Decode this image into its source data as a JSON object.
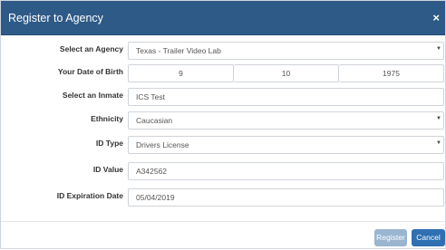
{
  "dialog": {
    "title": "Register to Agency",
    "close_glyph": "×"
  },
  "form": {
    "agency": {
      "label": "Select an Agency",
      "value": "Texas - Trailer Video Lab"
    },
    "dob": {
      "label": "Your Date of Birth",
      "month": "9",
      "day": "10",
      "year": "1975"
    },
    "inmate": {
      "label": "Select an Inmate",
      "value": "ICS Test"
    },
    "ethnicity": {
      "label": "Ethnicity",
      "value": "Caucasian"
    },
    "id_type": {
      "label": "ID Type",
      "value": "Drivers License"
    },
    "id_value": {
      "label": "ID Value",
      "value": "A342562"
    },
    "id_expiration": {
      "label": "ID Expiration Date",
      "value": "05/04/2019"
    }
  },
  "buttons": {
    "register": "Register",
    "cancel": "Cancel"
  },
  "icons": {
    "dropdown": "chevron-down-icon",
    "close": "close-icon"
  },
  "colors": {
    "header_bg": "#2e5a87",
    "register_bg": "#9ab5d0",
    "cancel_bg": "#2f6fb2"
  }
}
